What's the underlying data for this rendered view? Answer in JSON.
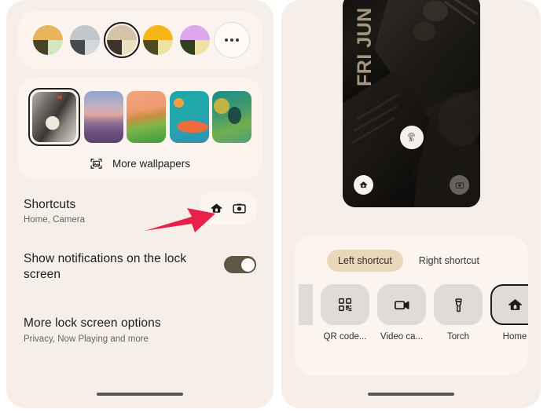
{
  "theme": {
    "page_bg": "#ffffff",
    "panel_bg": "#f6efe9",
    "card_bg": "#faf3ee",
    "accent_tab": "#ead7b9",
    "toggle_on": "#5f5743",
    "annotation_arrow": "#e8204a",
    "text_primary": "#1f1d1a",
    "text_secondary": "#6a6560"
  },
  "left_panel": {
    "color_swatches": {
      "name": "color-swatch-row",
      "items": [
        {
          "id": "swatch-1",
          "top": "#e7b35c",
          "bottom_left": "#4a4226",
          "bottom_right": "#cfe8c3",
          "selected": false
        },
        {
          "id": "swatch-2",
          "top": "#c3c6c9",
          "bottom_left": "#474a4d",
          "bottom_right": "#d5d8da",
          "selected": false
        },
        {
          "id": "swatch-3",
          "top": "#d4c3a5",
          "bottom_left": "#3b342a",
          "bottom_right": "#eddfc2",
          "selected": true
        },
        {
          "id": "swatch-4",
          "top": "#f5b718",
          "bottom_left": "#4d4a22",
          "bottom_right": "#ece3a2",
          "selected": false
        },
        {
          "id": "swatch-5",
          "top": "#dca7ef",
          "bottom_left": "#33401f",
          "bottom_right": "#ece3a2",
          "selected": false
        }
      ],
      "more_button": {
        "name": "more-colors-button",
        "label": "•••"
      }
    },
    "wallpapers": {
      "name": "wallpaper-row",
      "items": [
        {
          "id": "wallpaper-selected-thumbnail",
          "selected": true
        },
        {
          "id": "wallpaper-canyon-thumbnail",
          "selected": false
        },
        {
          "id": "wallpaper-landscape-thumbnail",
          "selected": false
        },
        {
          "id": "wallpaper-abstract-thumbnail",
          "selected": false
        },
        {
          "id": "wallpaper-teal-thumbnail",
          "selected": false
        }
      ],
      "more_wallpapers": {
        "label": "More wallpapers",
        "icon": "image-frame-icon"
      }
    },
    "settings_rows": [
      {
        "name": "shortcuts-row",
        "title": "Shortcuts",
        "subtitle": "Home, Camera",
        "control": "shortcut-icons",
        "icons": [
          "home-icon",
          "camera-icon"
        ]
      },
      {
        "name": "show-notifications-row",
        "title": "Show notifications on the lock screen",
        "subtitle": "",
        "control": "toggle",
        "toggle_state": "on"
      },
      {
        "name": "more-lock-screen-options-row",
        "title": "More lock screen options",
        "subtitle": "Privacy, Now Playing and more",
        "control": "none"
      }
    ],
    "annotation": {
      "name": "red-arrow-annotation",
      "color": "#e8204a",
      "points_to": "shortcuts-row"
    },
    "gesture_bar": {
      "name": "gesture-nav-bar"
    }
  },
  "right_panel": {
    "preview": {
      "name": "lock-screen-preview",
      "date_text": "FRI JUN",
      "fingerprint_icon": "fingerprint-icon",
      "left_shortcut_icon": "home-icon",
      "right_shortcut_icon": "camera-icon"
    },
    "shortcut_picker": {
      "name": "shortcut-picker-sheet",
      "tabs": [
        {
          "label": "Left shortcut",
          "active": true
        },
        {
          "label": "Right shortcut",
          "active": false
        }
      ],
      "options": [
        {
          "label": "",
          "icon": "partial-icon",
          "selected": false,
          "clipped": true
        },
        {
          "label": "QR code...",
          "icon": "qr-code-icon",
          "selected": false,
          "clipped": false
        },
        {
          "label": "Video ca...",
          "icon": "video-camera-icon",
          "selected": false,
          "clipped": false
        },
        {
          "label": "Torch",
          "icon": "torch-icon",
          "selected": false,
          "clipped": false
        },
        {
          "label": "Home",
          "icon": "home-icon",
          "selected": true,
          "clipped": false
        }
      ]
    },
    "gesture_bar": {
      "name": "gesture-nav-bar"
    }
  }
}
